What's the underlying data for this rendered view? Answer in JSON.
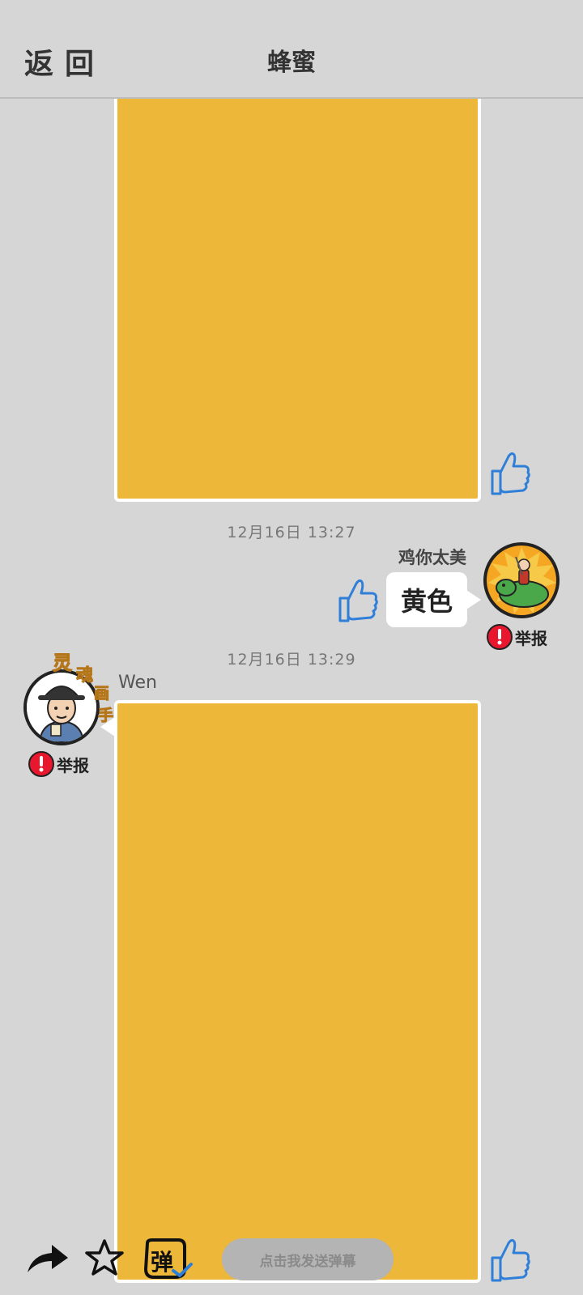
{
  "header": {
    "back_label": "返回",
    "title": "蜂蜜"
  },
  "messages": [
    {
      "timestamp": "12月16日  13:27",
      "username": "鸡你太美",
      "text": "黄色",
      "report_label": "举报"
    },
    {
      "timestamp": "12月16日  13:29",
      "username": "Wen",
      "report_label": "举报",
      "avatar_badge": [
        "灵",
        "魂",
        "画",
        "手"
      ]
    }
  ],
  "toolbar": {
    "danmaku_glyph": "弹",
    "danmaku_placeholder": "点击我发送弹幕"
  },
  "colors": {
    "background": "#d6d6d6",
    "picture_fill": "#edb73a",
    "like_blue": "#2f7fd8",
    "report_red": "#e8172e"
  },
  "icons": [
    "thumbs-up-icon",
    "share-arrow-icon",
    "star-icon",
    "danmaku-icon",
    "alert-icon"
  ]
}
